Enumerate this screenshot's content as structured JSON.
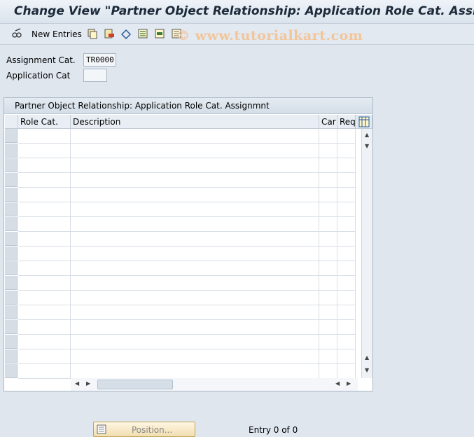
{
  "window": {
    "title": "Change View \"Partner Object Relationship: Application Role Cat. Assign"
  },
  "toolbar": {
    "new_entries_label": "New Entries",
    "icons": [
      "pencil-glasses-icon",
      "copy-icon",
      "delete-icon",
      "undo-icon",
      "select-all-icon",
      "select-block-icon",
      "deselect-icon"
    ]
  },
  "watermark": "© www.tutorialkart.com",
  "fields": {
    "assignment_cat_label": "Assignment Cat.",
    "assignment_cat_value": "TR0000",
    "application_cat_label": "Application Cat",
    "application_cat_value": ""
  },
  "table": {
    "title": "Partner Object Relationship: Application Role Cat. Assignmnt",
    "columns": [
      "Role Cat.",
      "Description",
      "Car",
      "Req"
    ],
    "rows": [
      [
        "",
        "",
        "",
        ""
      ],
      [
        "",
        "",
        "",
        ""
      ],
      [
        "",
        "",
        "",
        ""
      ],
      [
        "",
        "",
        "",
        ""
      ],
      [
        "",
        "",
        "",
        ""
      ],
      [
        "",
        "",
        "",
        ""
      ],
      [
        "",
        "",
        "",
        ""
      ],
      [
        "",
        "",
        "",
        ""
      ],
      [
        "",
        "",
        "",
        ""
      ],
      [
        "",
        "",
        "",
        ""
      ],
      [
        "",
        "",
        "",
        ""
      ],
      [
        "",
        "",
        "",
        ""
      ],
      [
        "",
        "",
        "",
        ""
      ],
      [
        "",
        "",
        "",
        ""
      ],
      [
        "",
        "",
        "",
        ""
      ],
      [
        "",
        "",
        "",
        ""
      ],
      [
        "",
        "",
        "",
        ""
      ]
    ]
  },
  "footer": {
    "position_button_label": "Position...",
    "entry_status": "Entry 0 of 0"
  },
  "colors": {
    "background": "#dfe6ee",
    "title_text": "#1c2a3a",
    "watermark": "#f2c59a",
    "button_fill": "#f1deb0"
  }
}
